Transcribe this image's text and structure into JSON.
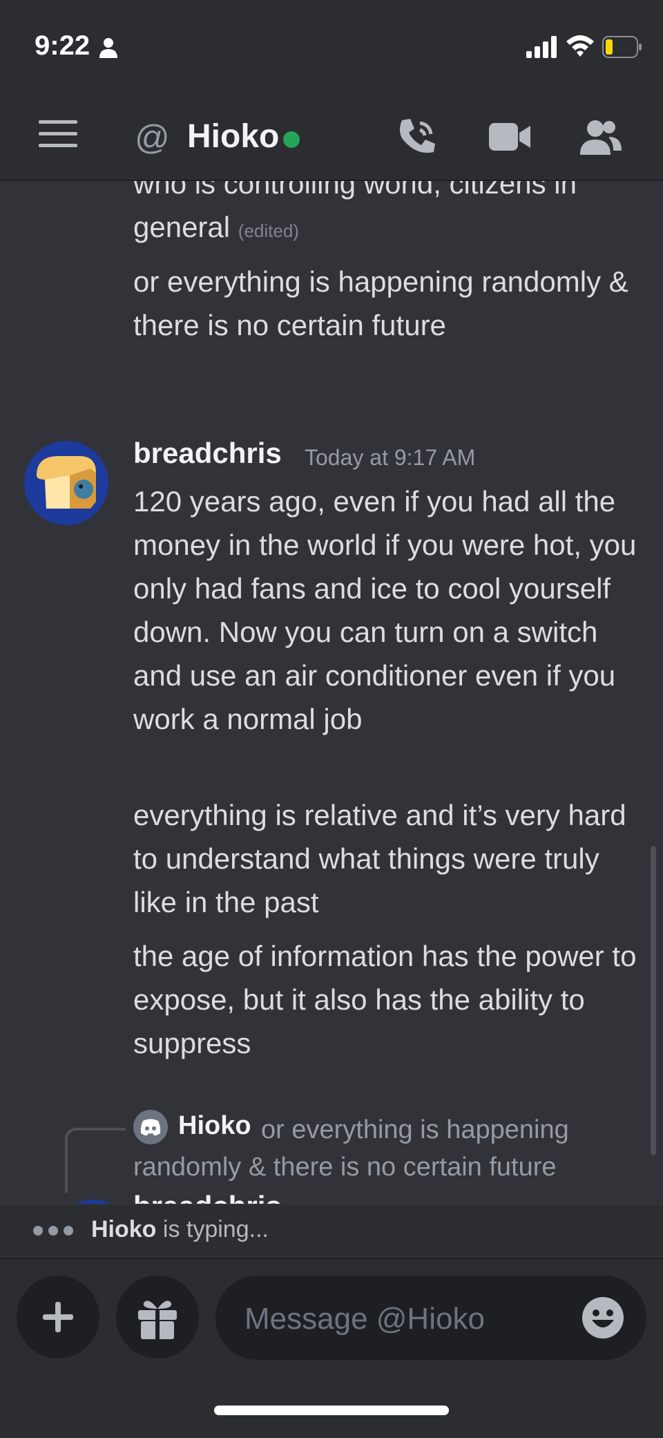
{
  "status": {
    "time": "9:22"
  },
  "header": {
    "title": "Hioko"
  },
  "messages": {
    "top_lines": [
      "who is controlling world, citizens in",
      "general"
    ],
    "edited_label": "(edited)",
    "top_message_2": "or everything is happening randomly & there is no certain future",
    "author": "breadchris",
    "timestamp": "Today at 9:17 AM",
    "body_1": "120 years ago, even if you had all the money in the world if you were hot, you only had fans and ice to cool yourself down. Now you can turn on a switch and use an air conditioner even if you work a normal job",
    "body_2": "everything is relative and it’s very hard to understand what things were truly like in the past",
    "body_3": "the age of information has the power to expose, but it also has the ability to suppress"
  },
  "reply": {
    "author": "Hioko",
    "text": "or everything is happening randomly & there is no certain future"
  },
  "next_message": {
    "author": "breadchris"
  },
  "typing": {
    "name": "Hioko",
    "suffix": " is typing..."
  },
  "composer": {
    "placeholder": "Message @Hioko"
  },
  "colors": {
    "online": "#23a55a",
    "background": "#313338",
    "header": "#2b2d31"
  }
}
